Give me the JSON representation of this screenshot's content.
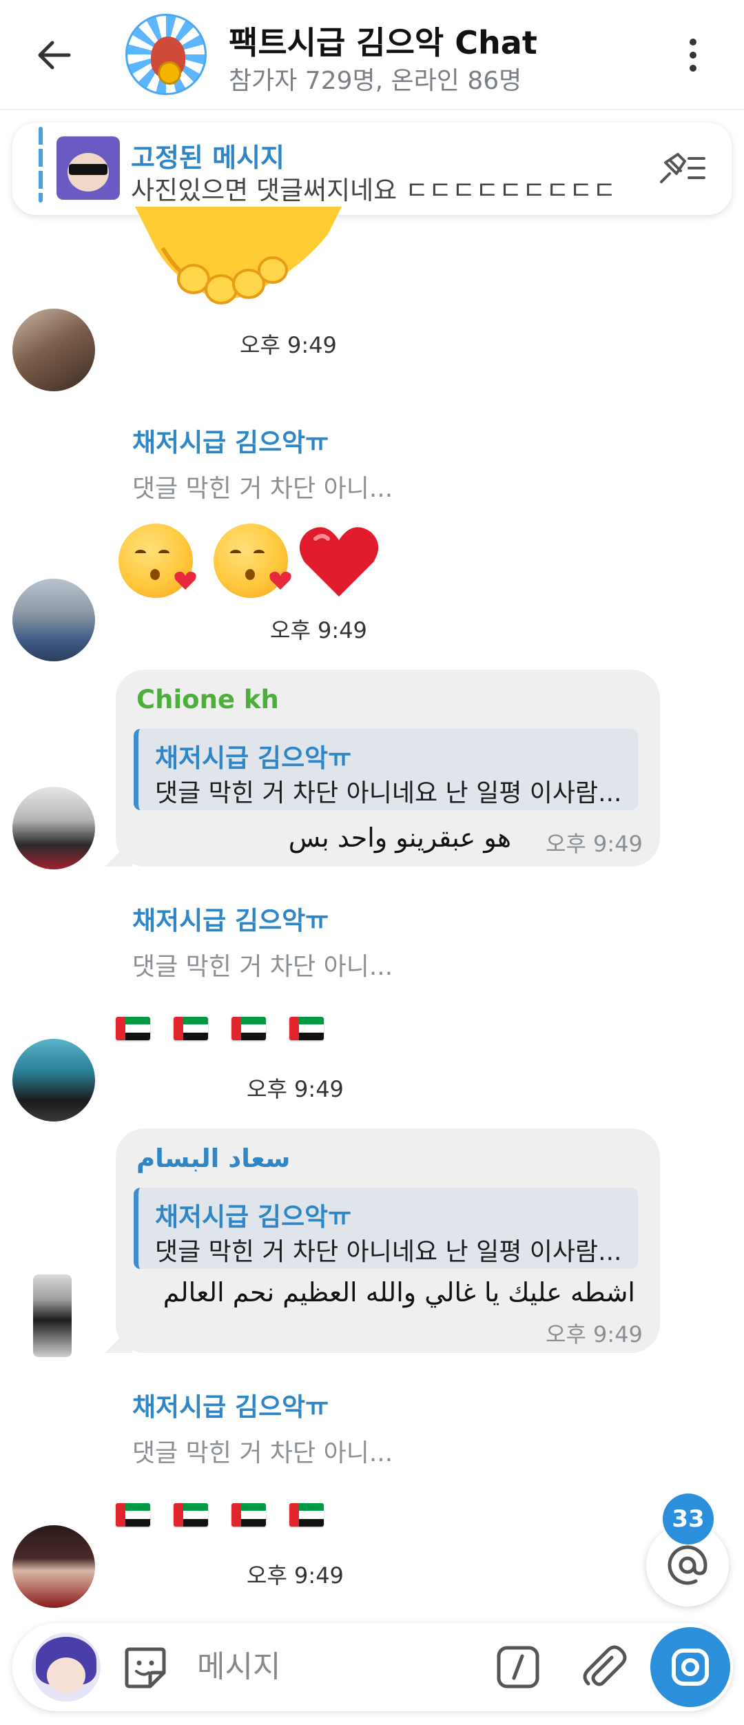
{
  "header": {
    "title": "팩트시급 김으악 Chat",
    "subtitle": "참가자 729명, 온라인 86명"
  },
  "pinned": {
    "title": "고정된 메시지",
    "text": "사진있으면 댓글써지네요 ㄷㄷㄷㄷㄷㄷㄷㄷㄷ"
  },
  "messages": [
    {
      "type": "sticker",
      "sticker": "handshake",
      "time": "오후 9:49"
    },
    {
      "type": "reply_emoji",
      "reply_name": "채저시급 김으악ㅠ",
      "reply_text": "댓글 막힌 거 차단 아니...",
      "emojis": [
        "kissing-heart",
        "kissing-heart",
        "red-heart"
      ],
      "time": "오후 9:49"
    },
    {
      "type": "bubble",
      "sender": "Chione kh",
      "sender_color": "#4caf3c",
      "quote_name": "채저시급 김으악ㅠ",
      "quote_text": "댓글 막힌 거 차단 아니네요 난 일평 이사람...",
      "text": "هو عبقرينو واحد بس",
      "time": "오후 9:49"
    },
    {
      "type": "reply_emoji",
      "reply_name": "채저시급 김으악ㅠ",
      "reply_text": "댓글 막힌 거 차단 아니...",
      "emojis": [
        "uae-flag",
        "uae-flag",
        "uae-flag",
        "uae-flag"
      ],
      "time": "오후 9:49"
    },
    {
      "type": "bubble",
      "sender": "سعاد البسام",
      "sender_color": "#2e86c7",
      "quote_name": "채저시급 김으악ㅠ",
      "quote_text": "댓글 막힌 거 차단 아니네요 난 일평 이사람...",
      "text": "اشطه عليك يا غالي والله العظيم نحم العالم",
      "time": "오후 9:49"
    },
    {
      "type": "reply_emoji",
      "reply_name": "채저시급 김으악ㅠ",
      "reply_text": "댓글 막힌 거 차단 아니...",
      "emojis": [
        "uae-flag",
        "uae-flag",
        "uae-flag",
        "uae-flag"
      ],
      "time": "오후 9:49"
    }
  ],
  "mentions": {
    "count": "33"
  },
  "input": {
    "placeholder": "메시지"
  },
  "colors": {
    "accent": "#2b8fdc",
    "link": "#2e86c7",
    "bubble": "#efefef"
  }
}
